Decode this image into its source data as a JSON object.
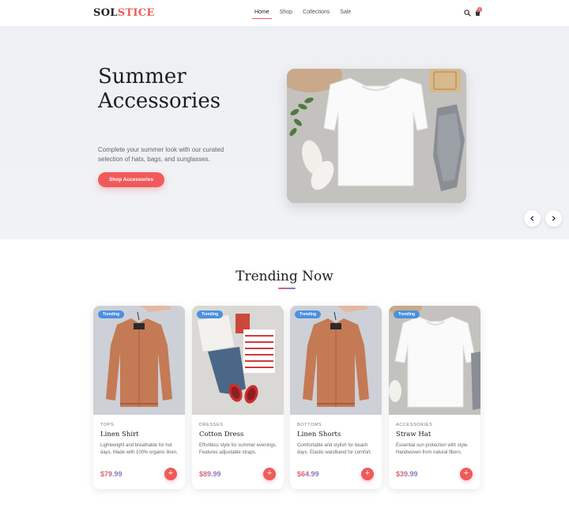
{
  "header": {
    "logo_part1": "SOL",
    "logo_part2": "STICE",
    "nav": [
      "Home",
      "Shop",
      "Collections",
      "Sale"
    ],
    "cart_count": "0"
  },
  "hero": {
    "title_line1": "Summer",
    "title_line2": "Accessories",
    "description": "Complete your summer look with our curated selection of hats, bags, and sunglasses.",
    "button_label": "Shop Accessories"
  },
  "trending": {
    "title": "Trending Now",
    "products": [
      {
        "badge": "Trending",
        "category": "TOPS",
        "name": "Linen Shirt",
        "description": "Lightweight and breathable for hot days. Made with 100% organic linen.",
        "price": "$79.99",
        "image": "jacket"
      },
      {
        "badge": "Trending",
        "category": "DRESSES",
        "name": "Cotton Dress",
        "description": "Effortless style for summer evenings. Features adjustable straps.",
        "price": "$89.99",
        "image": "flatlay"
      },
      {
        "badge": "Trending",
        "category": "BOTTOMS",
        "name": "Linen Shorts",
        "description": "Comfortable and stylish for beach days. Elastic waistband for comfort.",
        "price": "$64.99",
        "image": "jacket"
      },
      {
        "badge": "Trending",
        "category": "ACCESSORIES",
        "name": "Straw Hat",
        "description": "Essential sun protection with style. Handwoven from natural fibers.",
        "price": "$39.99",
        "image": "sweatshirt"
      }
    ]
  },
  "colors": {
    "accent": "#f05a5a",
    "badge": "#4a90e2",
    "price_gradient": [
      "#f05a5a",
      "#6b7fd7"
    ]
  }
}
